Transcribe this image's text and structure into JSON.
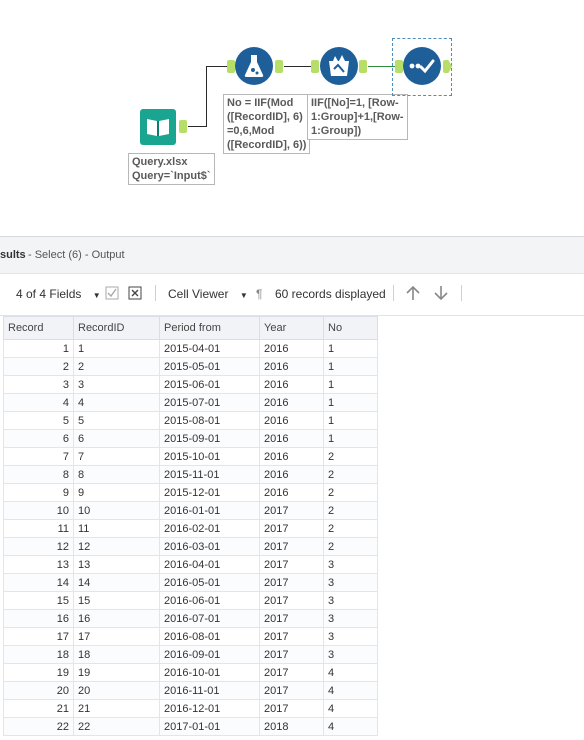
{
  "workflow": {
    "input_annotation": "Query.xlsx\nQuery=`Input$`",
    "formula_annotation": "No = IIF(Mod\n([RecordID], 6)\n=0,6,Mod\n([RecordID], 6))",
    "multirow_annotation": "IIF([No]=1, [Row-\n1:Group]+1,[Row-\n1:Group])"
  },
  "results": {
    "title_prefix": "sults",
    "title_suffix": " - Select (6) - Output",
    "fields_label": "4 of 4 Fields",
    "cell_viewer_label": "Cell Viewer",
    "records_label": "60 records displayed",
    "columns": [
      "Record",
      "RecordID",
      "Period from",
      "Year",
      "No"
    ],
    "rows": [
      [
        "1",
        "1",
        "2015-04-01",
        "2016",
        "1"
      ],
      [
        "2",
        "2",
        "2015-05-01",
        "2016",
        "1"
      ],
      [
        "3",
        "3",
        "2015-06-01",
        "2016",
        "1"
      ],
      [
        "4",
        "4",
        "2015-07-01",
        "2016",
        "1"
      ],
      [
        "5",
        "5",
        "2015-08-01",
        "2016",
        "1"
      ],
      [
        "6",
        "6",
        "2015-09-01",
        "2016",
        "1"
      ],
      [
        "7",
        "7",
        "2015-10-01",
        "2016",
        "2"
      ],
      [
        "8",
        "8",
        "2015-11-01",
        "2016",
        "2"
      ],
      [
        "9",
        "9",
        "2015-12-01",
        "2016",
        "2"
      ],
      [
        "10",
        "10",
        "2016-01-01",
        "2017",
        "2"
      ],
      [
        "11",
        "11",
        "2016-02-01",
        "2017",
        "2"
      ],
      [
        "12",
        "12",
        "2016-03-01",
        "2017",
        "2"
      ],
      [
        "13",
        "13",
        "2016-04-01",
        "2017",
        "3"
      ],
      [
        "14",
        "14",
        "2016-05-01",
        "2017",
        "3"
      ],
      [
        "15",
        "15",
        "2016-06-01",
        "2017",
        "3"
      ],
      [
        "16",
        "16",
        "2016-07-01",
        "2017",
        "3"
      ],
      [
        "17",
        "17",
        "2016-08-01",
        "2017",
        "3"
      ],
      [
        "18",
        "18",
        "2016-09-01",
        "2017",
        "3"
      ],
      [
        "19",
        "19",
        "2016-10-01",
        "2017",
        "4"
      ],
      [
        "20",
        "20",
        "2016-11-01",
        "2017",
        "4"
      ],
      [
        "21",
        "21",
        "2016-12-01",
        "2017",
        "4"
      ],
      [
        "22",
        "22",
        "2017-01-01",
        "2018",
        "4"
      ]
    ]
  },
  "icons": {
    "input": "book-icon",
    "formula": "flask-icon",
    "multirow": "multirow-icon",
    "select": "checkmark-dots-icon",
    "field_dropdown": "chevron-down-icon",
    "check": "checkbox-icon",
    "close": "close-box-icon",
    "pilcrow": "pilcrow-icon",
    "up": "arrow-up-icon",
    "down": "arrow-down-icon"
  },
  "colors": {
    "tool_blue": "#1f5f99",
    "input_teal": "#1aa591",
    "anchor_green": "#b6de68"
  }
}
